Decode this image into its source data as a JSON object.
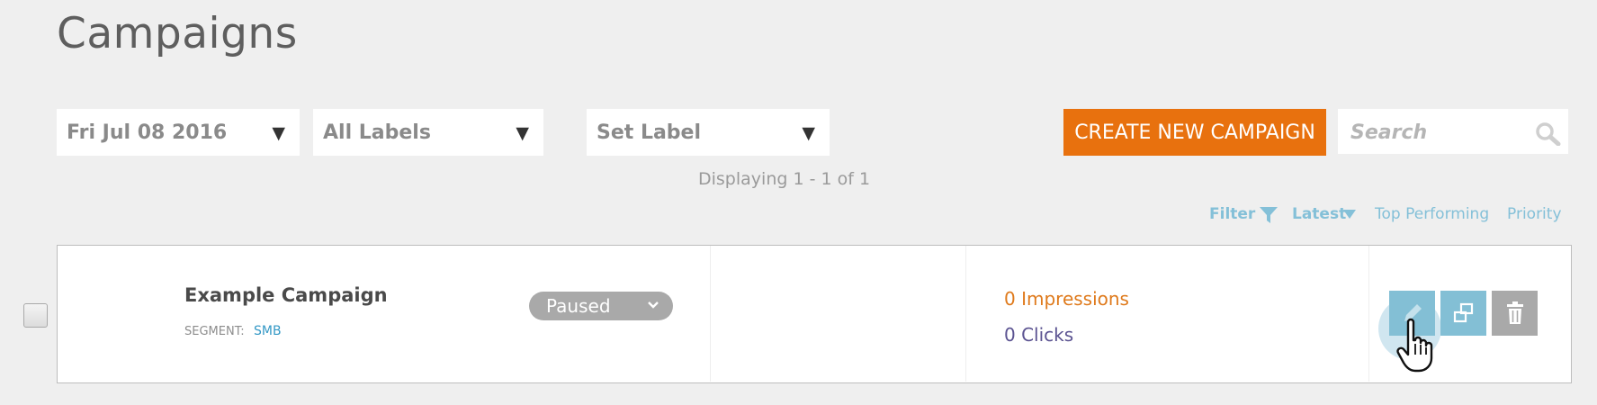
{
  "page": {
    "title": "Campaigns"
  },
  "filters": {
    "date": "Fri Jul 08 2016",
    "labels": "All Labels",
    "set_label": "Set Label"
  },
  "toolbar": {
    "create_button": "CREATE NEW CAMPAIGN",
    "search_placeholder": "Search"
  },
  "pagination": {
    "displaying": "Displaying 1 - 1 of 1"
  },
  "sort": {
    "filter_label": "Filter",
    "latest_label": "Latest",
    "top_performing_label": "Top Performing",
    "priority_label": "Priority"
  },
  "campaigns": [
    {
      "name": "Example Campaign",
      "segment_label": "SEGMENT:",
      "segment_value": "SMB",
      "status": "Paused",
      "impressions": "0 Impressions",
      "clicks": "0 Clicks",
      "actions": [
        "pencil-icon",
        "duplicate-icon",
        "trash-icon"
      ]
    }
  ],
  "colors": {
    "accent": "#e8710e",
    "link": "#84c0d8",
    "impressions": "#df7a1c",
    "clicks": "#5b5391",
    "action_blue": "#83bfd5",
    "action_gray": "#a9a9a9"
  }
}
